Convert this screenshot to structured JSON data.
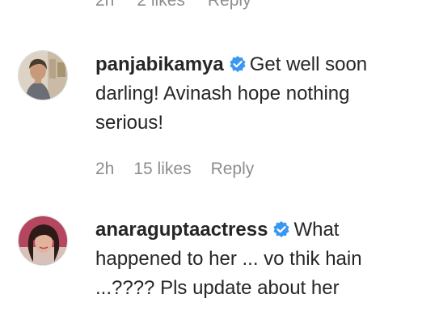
{
  "top_meta": {
    "time": "2h",
    "likes": "2 likes",
    "reply": "Reply"
  },
  "comments": [
    {
      "username": "panjabikamya",
      "verified": true,
      "text": "Get well soon darling! Avinash hope nothing serious!",
      "time": "2h",
      "likes": "15 likes",
      "reply": "Reply",
      "avatar_icon": "user-avatar-photo"
    },
    {
      "username": "anaraguptaactress",
      "verified": true,
      "text": "What happened to her ... vo thik hain ...???? Pls update about her",
      "avatar_icon": "user-avatar-photo"
    }
  ],
  "colors": {
    "text": "#262626",
    "secondary": "#8e8e8e",
    "verified_badge": "#3897f0"
  }
}
